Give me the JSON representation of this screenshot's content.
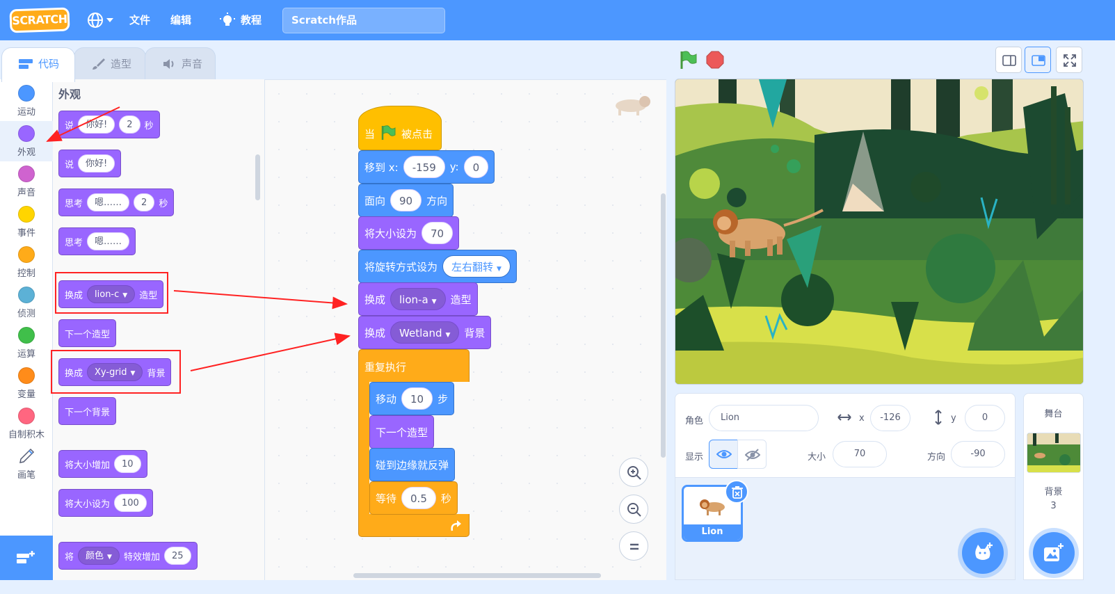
{
  "menubar": {
    "logo": "SCRATCH",
    "language_icon": "globe-icon",
    "file": "文件",
    "edit": "编辑",
    "tutorials": "教程",
    "project_title": "Scratch作品",
    "brand_color": "#4c97ff"
  },
  "tabs": [
    {
      "label": "代码",
      "icon": "code-icon",
      "active": true
    },
    {
      "label": "造型",
      "icon": "brush-icon",
      "active": false
    },
    {
      "label": "声音",
      "icon": "speaker-icon",
      "active": false
    }
  ],
  "categories": [
    {
      "label": "运动",
      "color": "#4c97ff"
    },
    {
      "label": "外观",
      "color": "#9966ff",
      "selected": true
    },
    {
      "label": "声音",
      "color": "#cf63cf"
    },
    {
      "label": "事件",
      "color": "#ffd500"
    },
    {
      "label": "控制",
      "color": "#ffab19"
    },
    {
      "label": "侦测",
      "color": "#5cb1d6"
    },
    {
      "label": "运算",
      "color": "#40bf4a"
    },
    {
      "label": "变量",
      "color": "#ff8c1a"
    },
    {
      "label": "自制积木",
      "color": "#ff6680"
    },
    {
      "label": "画笔",
      "icon": "pen-icon"
    }
  ],
  "palette": {
    "heading": "外观",
    "b1": {
      "say": "说",
      "text": "你好!",
      "secs": "2",
      "unit": "秒"
    },
    "b2": {
      "say": "说",
      "text": "你好!"
    },
    "b3": {
      "think": "思考",
      "text": "嗯……",
      "secs": "2",
      "unit": "秒"
    },
    "b4": {
      "think": "思考",
      "text": "嗯……"
    },
    "b5": {
      "switch": "换成",
      "costume": "lion-c",
      "suffix": "造型"
    },
    "b6": {
      "label": "下一个造型"
    },
    "b7": {
      "switch": "换成",
      "backdrop": "Xy-grid",
      "suffix": "背景"
    },
    "b8": {
      "label": "下一个背景"
    },
    "b9": {
      "label": "将大小增加",
      "value": "10"
    },
    "b10": {
      "label": "将大小设为",
      "value": "100"
    },
    "b11": {
      "pre": "将",
      "effect": "颜色",
      "mid": "特效增加",
      "value": "25"
    }
  },
  "script": {
    "hat": {
      "when": "当",
      "clicked": "被点击"
    },
    "goto": {
      "label": "移到 x:",
      "x": "-159",
      "ylabel": "y:",
      "y": "0"
    },
    "point": {
      "label": "面向",
      "value": "90",
      "suffix": "方向"
    },
    "setsize": {
      "label": "将大小设为",
      "value": "70"
    },
    "rotation": {
      "label": "将旋转方式设为",
      "value": "左右翻转"
    },
    "costume": {
      "label": "换成",
      "value": "lion-a",
      "suffix": "造型"
    },
    "backdrop": {
      "label": "换成",
      "value": "Wetland",
      "suffix": "背景"
    },
    "forever": "重复执行",
    "move": {
      "label": "移动",
      "value": "10",
      "suffix": "步"
    },
    "nextcostume": "下一个造型",
    "bounce": "碰到边缘就反弹",
    "wait": {
      "label": "等待",
      "value": "0.5",
      "suffix": "秒"
    }
  },
  "sprite_info": {
    "sprite_label": "角色",
    "sprite_name": "Lion",
    "x_label": "x",
    "x": "-126",
    "y_label": "y",
    "y": "0",
    "show_label": "显示",
    "size_label": "大小",
    "size": "70",
    "direction_label": "方向",
    "direction": "-90"
  },
  "sprites": [
    {
      "name": "Lion",
      "selected": true
    }
  ],
  "stage_panel": {
    "title": "舞台",
    "backdrops_label": "背景",
    "backdrops_count": "3"
  }
}
